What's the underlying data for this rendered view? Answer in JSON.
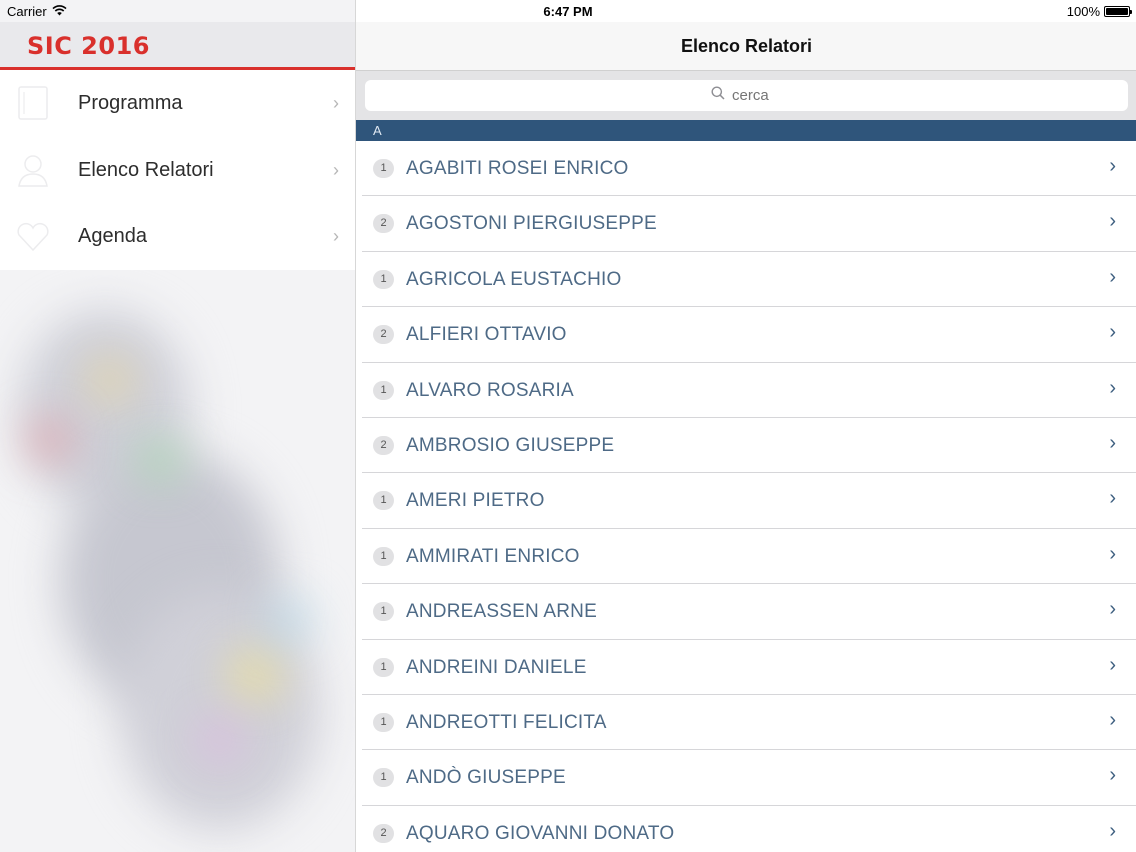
{
  "status_bar": {
    "carrier": "Carrier",
    "time": "6:47 PM",
    "battery": "100%",
    "icons": [
      "wifi-icon",
      "battery-icon"
    ]
  },
  "sidebar": {
    "logo": "SIC 2016",
    "items": [
      {
        "label": "Programma",
        "icon": "document-icon"
      },
      {
        "label": "Elenco Relatori",
        "icon": "person-icon"
      },
      {
        "label": "Agenda",
        "icon": "heart-icon"
      }
    ]
  },
  "main": {
    "title": "Elenco Relatori",
    "search": {
      "placeholder": "cerca"
    },
    "section": "A",
    "rows": [
      {
        "count": "1",
        "name": "AGABITI ROSEI ENRICO"
      },
      {
        "count": "2",
        "name": "AGOSTONI PIERGIUSEPPE"
      },
      {
        "count": "1",
        "name": "AGRICOLA EUSTACHIO"
      },
      {
        "count": "2",
        "name": "ALFIERI OTTAVIO"
      },
      {
        "count": "1",
        "name": "ALVARO ROSARIA"
      },
      {
        "count": "2",
        "name": "AMBROSIO GIUSEPPE"
      },
      {
        "count": "1",
        "name": "AMERI PIETRO"
      },
      {
        "count": "1",
        "name": "AMMIRATI ENRICO"
      },
      {
        "count": "1",
        "name": "ANDREASSEN ARNE"
      },
      {
        "count": "1",
        "name": "ANDREINI DANIELE"
      },
      {
        "count": "1",
        "name": "ANDREOTTI FELICITA"
      },
      {
        "count": "1",
        "name": "ANDÒ GIUSEPPE"
      },
      {
        "count": "2",
        "name": "AQUARO GIOVANNI DONATO"
      }
    ]
  },
  "colors": {
    "brand_red": "#d9302c",
    "section_blue": "#2f557b",
    "name_text": "#4e6a86"
  }
}
